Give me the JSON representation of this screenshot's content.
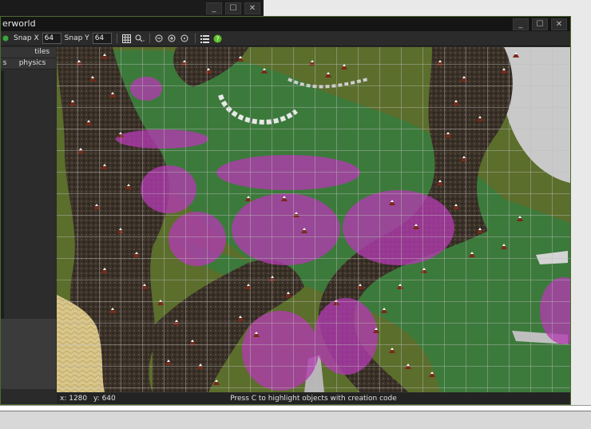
{
  "background_window": {
    "controls": [
      "_",
      "☐",
      "✕"
    ]
  },
  "window": {
    "title": "erworld",
    "controls": [
      "_",
      "☐",
      "✕"
    ],
    "accent": "#4d6b2f"
  },
  "toolbar": {
    "snap_x_label": "Snap X",
    "snap_x_value": "64",
    "snap_y_label": "Snap Y",
    "snap_y_value": "64",
    "icons": [
      "grid-icon",
      "zoom-icon",
      "zoom-out-icon",
      "zoom-in-icon",
      "zoom-reset-icon",
      "list-icon",
      "help-icon"
    ]
  },
  "left_panel": {
    "tabs_top": [
      "tiles"
    ],
    "tabs_bottom": [
      "s",
      "physics"
    ]
  },
  "statusbar": {
    "x": "x: 1280",
    "y": "y: 640",
    "message": "Press C to highlight objects with creation code"
  },
  "colors": {
    "grass_dark": "#3c7a3b",
    "grass_olive": "#5b6e2c",
    "rock": "#3a3128",
    "highlight": "#b23bb0",
    "snow_rock": "#c9c9c9",
    "sand": "#d9c68a"
  }
}
